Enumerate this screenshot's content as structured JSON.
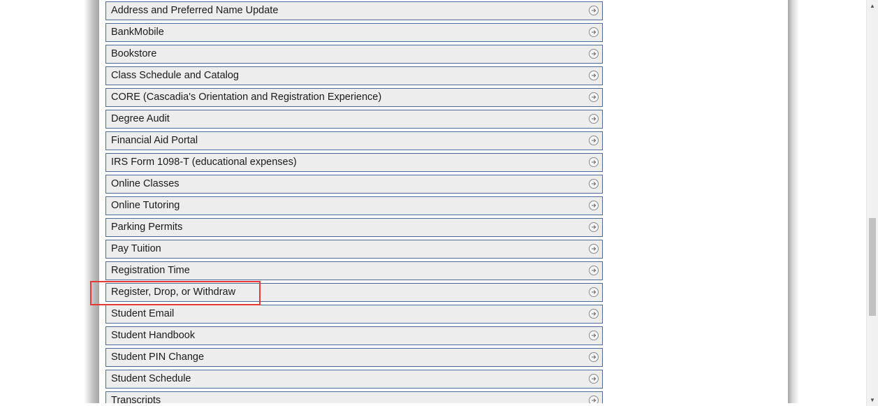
{
  "links": [
    {
      "label": "Address and Preferred Name Update",
      "icon": "arrow-circle-icon"
    },
    {
      "label": "BankMobile",
      "icon": "arrow-circle-icon"
    },
    {
      "label": "Bookstore",
      "icon": "arrow-circle-icon"
    },
    {
      "label": "Class Schedule and Catalog",
      "icon": "arrow-circle-icon"
    },
    {
      "label": "CORE (Cascadia's Orientation and Registration Experience)",
      "icon": "arrow-circle-icon"
    },
    {
      "label": "Degree Audit",
      "icon": "arrow-circle-icon"
    },
    {
      "label": "Financial Aid Portal",
      "icon": "arrow-circle-icon"
    },
    {
      "label": "IRS Form 1098-T (educational expenses)",
      "icon": "arrow-circle-icon"
    },
    {
      "label": "Online Classes",
      "icon": "arrow-circle-icon"
    },
    {
      "label": "Online Tutoring",
      "icon": "arrow-circle-icon"
    },
    {
      "label": "Parking Permits",
      "icon": "arrow-circle-icon"
    },
    {
      "label": "Pay Tuition",
      "icon": "arrow-circle-icon"
    },
    {
      "label": "Registration Time",
      "icon": "arrow-circle-icon"
    },
    {
      "label": "Register, Drop, or Withdraw",
      "icon": "arrow-circle-icon",
      "highlighted": true
    },
    {
      "label": "Student Email",
      "icon": "arrow-circle-icon"
    },
    {
      "label": "Student Handbook",
      "icon": "arrow-circle-icon"
    },
    {
      "label": "Student PIN Change",
      "icon": "arrow-circle-icon"
    },
    {
      "label": "Student Schedule",
      "icon": "arrow-circle-icon"
    },
    {
      "label": "Transcripts",
      "icon": "arrow-circle-icon"
    }
  ],
  "colors": {
    "item_background": "#ededed",
    "item_border": "#4a6a9a",
    "highlight": "#e53935"
  }
}
